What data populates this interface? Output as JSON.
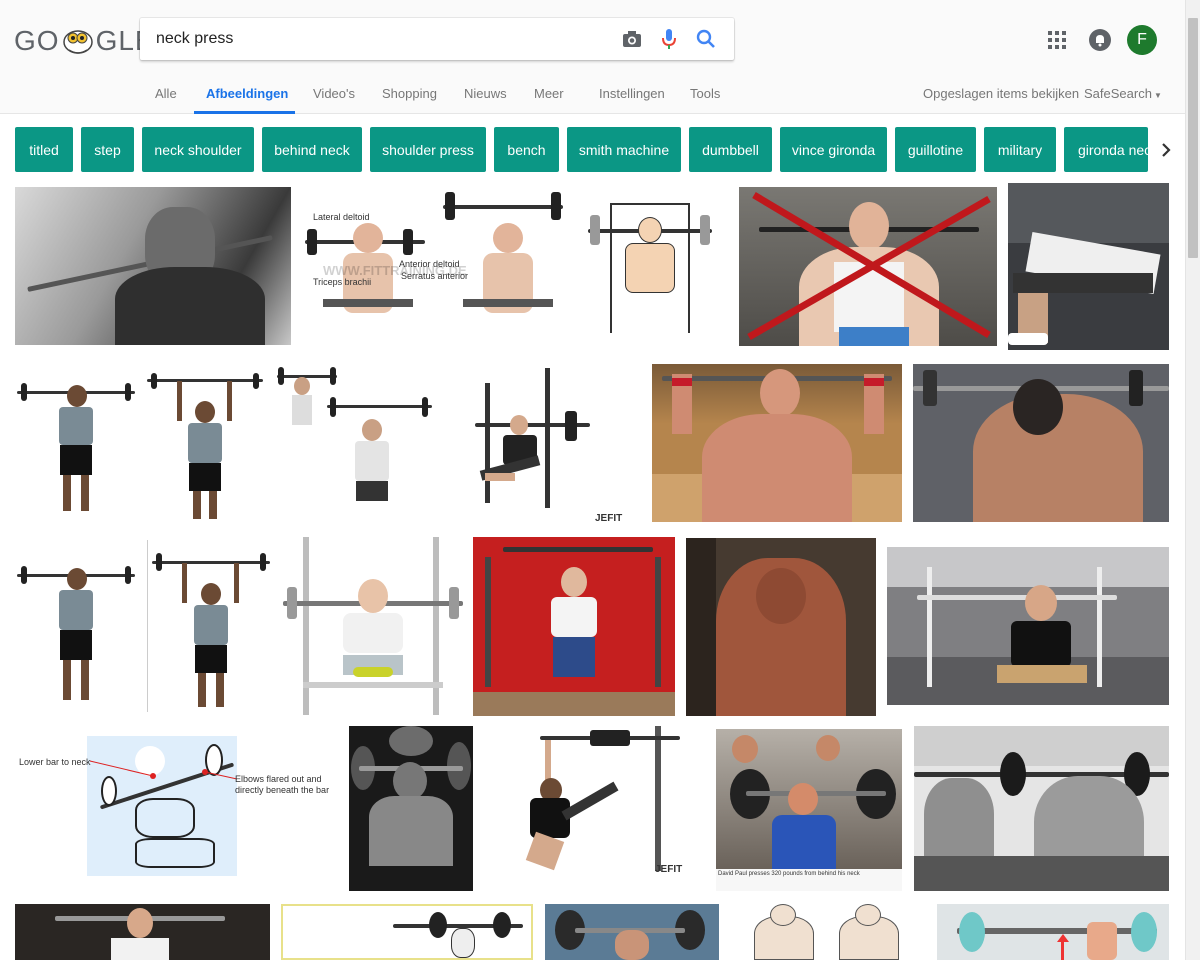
{
  "logo": {
    "text_left": "GO",
    "text_right": "GLE"
  },
  "search": {
    "query": "neck press"
  },
  "header_icons": [
    "camera-icon",
    "microphone-icon",
    "search-icon",
    "apps-icon",
    "notifications-icon"
  ],
  "account": {
    "initial": "F",
    "color": "#1e7a2d"
  },
  "tabs": [
    {
      "label": "Alle"
    },
    {
      "label": "Afbeeldingen",
      "active": true
    },
    {
      "label": "Video's"
    },
    {
      "label": "Shopping"
    },
    {
      "label": "Nieuws"
    },
    {
      "label": "Meer"
    },
    {
      "label": "Instellingen"
    },
    {
      "label": "Tools"
    }
  ],
  "right_links": {
    "saved": "Opgeslagen items bekijken",
    "safesearch": "SafeSearch"
  },
  "chips": [
    "titled",
    "step",
    "neck shoulder",
    "behind neck",
    "shoulder press",
    "bench",
    "smith machine",
    "dumbbell",
    "vince gironda",
    "guillotine",
    "military",
    "gironda neck"
  ],
  "chip_color": "#0b9785",
  "accent": "#1a73e8",
  "image_texts": {
    "diagram1": {
      "lateral": "Lateral deltoid",
      "anterior": "Anterior deltoid",
      "serratus": "Serratus anterior",
      "triceps": "Triceps brachii",
      "watermark": "WWW.FITTRAINING.DE"
    },
    "jefit1": "JEFIT",
    "bench_diagram": {
      "lower": "Lower bar to neck",
      "elbows1": "Elbows flared out and",
      "elbows2": "directly beneath the bar"
    },
    "jefit2": "JEFIT",
    "magazine_caption": "David Paul presses 320 pounds from behind his neck"
  }
}
